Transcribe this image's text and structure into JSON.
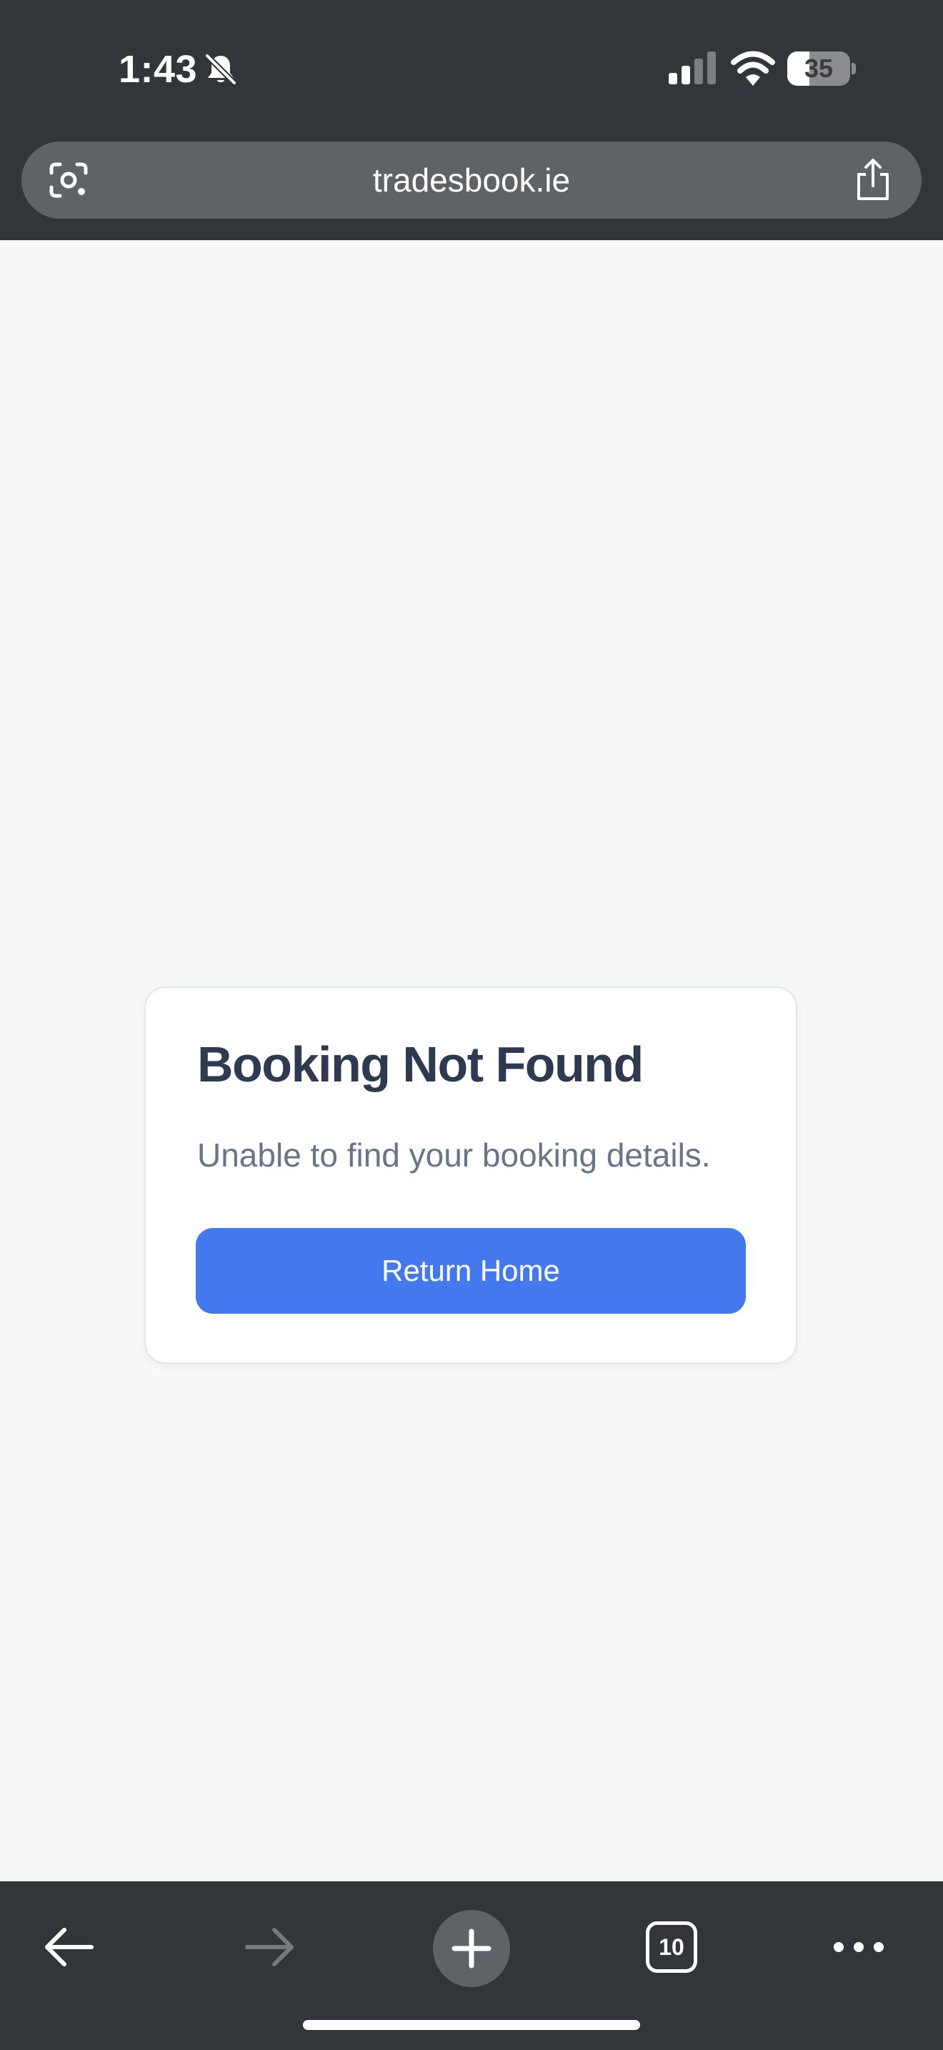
{
  "status_bar": {
    "time": "1:43",
    "battery_level": "35",
    "battery_fraction": 0.35,
    "icons": [
      "bell-slash-icon",
      "cellular-signal-icon",
      "wifi-icon",
      "battery-icon"
    ]
  },
  "browser": {
    "url": "tradesbook.ie",
    "left_icon": "google-lens-icon",
    "right_icon": "share-icon"
  },
  "page": {
    "title": "Booking Not Found",
    "message": "Unable to find your booking details.",
    "button_label": "Return Home"
  },
  "toolbar": {
    "tab_count": "10",
    "items": [
      "back-arrow-icon",
      "forward-arrow-icon",
      "new-tab-plus-icon",
      "tabs-icon",
      "more-icon"
    ]
  },
  "colors": {
    "chrome_background": "#323539",
    "url_bar": "#5f6367",
    "page_background": "#f7f8f8",
    "card_background": "#ffffff",
    "title_text": "#2d3a50",
    "message_text": "#66758a",
    "button_primary": "#4478ef"
  }
}
